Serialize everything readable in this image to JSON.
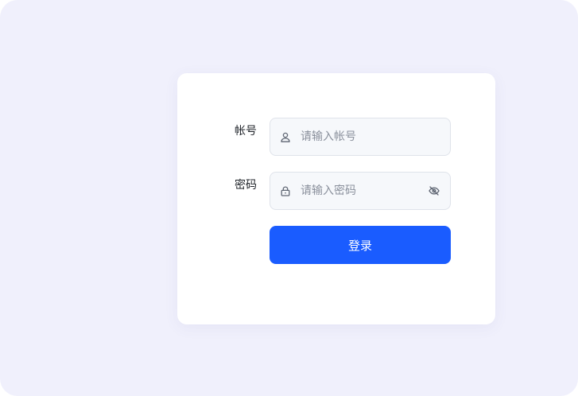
{
  "login_form": {
    "account": {
      "label": "帐号",
      "placeholder": "请输入帐号",
      "value": "",
      "icon": "user-icon"
    },
    "password": {
      "label": "密码",
      "placeholder": "请输入密码",
      "value": "",
      "icon": "lock-icon",
      "toggle_icon": "eye-off-icon"
    },
    "submit_label": "登录"
  },
  "colors": {
    "page_background": "#f0f0fc",
    "card_background": "#ffffff",
    "input_background": "#f6f8fb",
    "input_border": "#dfe3ea",
    "primary_button": "#1a5cff",
    "label_text": "#1f2329",
    "placeholder_text": "#8a909c",
    "icon_gray": "#5f6673"
  }
}
